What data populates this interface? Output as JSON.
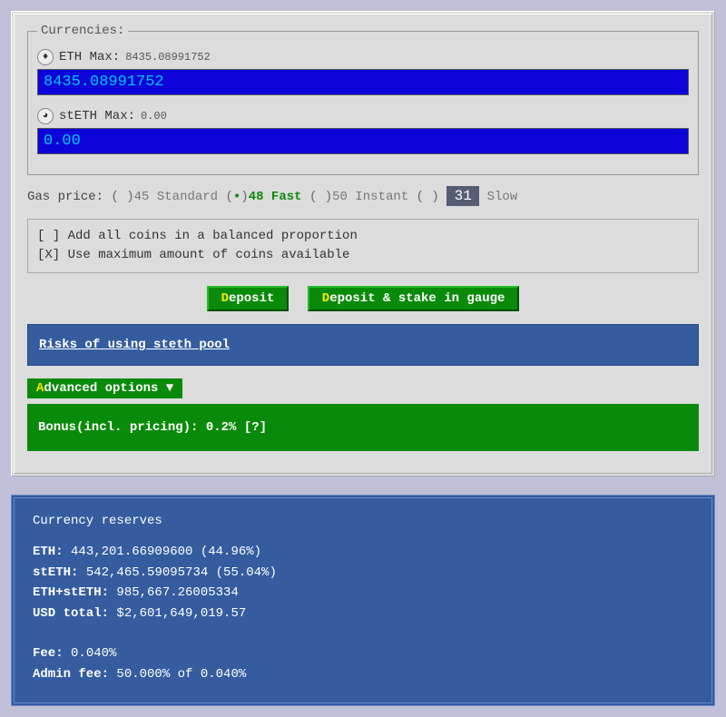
{
  "currencies": {
    "legend": "Currencies:",
    "eth": {
      "label": "ETH Max:",
      "max": "8435.08991752",
      "value": "8435.08991752"
    },
    "steth": {
      "label": "stETH Max:",
      "max": "0.00",
      "value": "0.00"
    }
  },
  "gas": {
    "label": "Gas price:",
    "standard": {
      "num": "45",
      "text": "Standard"
    },
    "fast": {
      "num": "48",
      "text": "Fast"
    },
    "instant": {
      "num": "50",
      "text": "Instant"
    },
    "custom": {
      "value": "31",
      "text": "Slow"
    }
  },
  "checks": {
    "balanced": "Add all coins in a balanced proportion",
    "usemax": "Use maximum amount of coins available"
  },
  "buttons": {
    "deposit_hot": "D",
    "deposit_rest": "eposit",
    "stake_hot": "D",
    "stake_rest": "eposit & stake in gauge"
  },
  "risk": {
    "text": "Risks of using steth pool"
  },
  "advanced": {
    "hot": "A",
    "rest": "dvanced options ▼"
  },
  "bonus": {
    "label": "Bonus(incl. pricing):",
    "value": "0.2%",
    "q": "[?]"
  },
  "reserves": {
    "header": "Currency reserves",
    "eth_label": "ETH:",
    "eth_val": "443,201.66909600 (44.96%)",
    "steth_label": "stETH:",
    "steth_val": "542,465.59095734 (55.04%)",
    "sum_label": "ETH+stETH:",
    "sum_val": "985,667.26005334",
    "usd_label": "USD total:",
    "usd_val": "$2,601,649,019.57",
    "fee_label": "Fee:",
    "fee_val": "0.040%",
    "admin_label": "Admin fee:",
    "admin_val": "50.000% of 0.040%"
  }
}
